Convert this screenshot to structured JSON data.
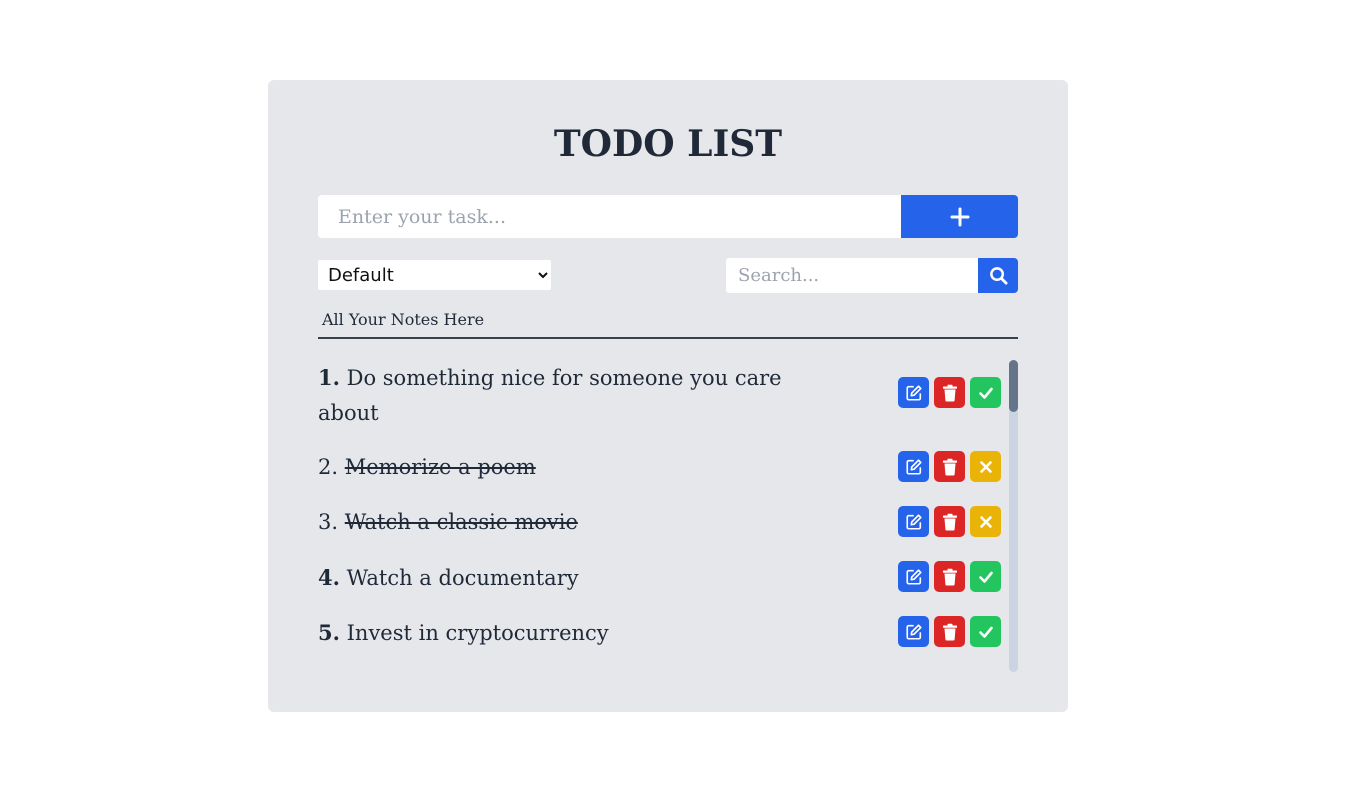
{
  "app": {
    "title": "TODO LIST"
  },
  "add_task": {
    "placeholder": "Enter your task...",
    "button_icon": "plus-icon"
  },
  "filter": {
    "selected": "Default"
  },
  "search": {
    "placeholder": "Search...",
    "button_icon": "search-icon"
  },
  "notes": {
    "section_label": "All Your Notes Here",
    "items": [
      {
        "num": "1.",
        "text": "Do something nice for someone you care about",
        "completed": false
      },
      {
        "num": "2.",
        "text": "Memorize a poem",
        "completed": true
      },
      {
        "num": "3.",
        "text": "Watch a classic movie",
        "completed": true
      },
      {
        "num": "4.",
        "text": "Watch a documentary",
        "completed": false
      },
      {
        "num": "5.",
        "text": "Invest in cryptocurrency",
        "completed": false
      }
    ]
  },
  "colors": {
    "primary": "#2563eb",
    "danger": "#dc2626",
    "success": "#22c55e",
    "warning": "#eab308",
    "card_bg": "#e5e7eb"
  }
}
